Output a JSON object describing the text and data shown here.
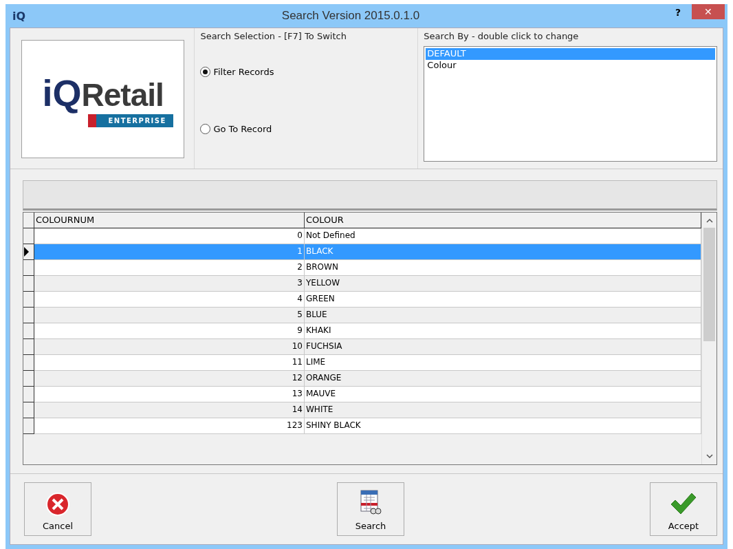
{
  "window": {
    "app_mark": "iQ",
    "title": "Search Version 2015.0.1.0",
    "help": "?",
    "close": "✕"
  },
  "logo": {
    "mark": "iQ",
    "name": "Retail",
    "tagline": "ENTERPRISE"
  },
  "search_selection": {
    "title": "Search Selection - [F7] To Switch",
    "options": [
      {
        "label": "Filter Records",
        "selected": true
      },
      {
        "label": "Go To Record",
        "selected": false
      }
    ]
  },
  "search_by": {
    "title": "Search By - double click to change",
    "items": [
      {
        "label": "DEFAULT",
        "selected": true
      },
      {
        "label": "Colour",
        "selected": false
      }
    ]
  },
  "table": {
    "columns": [
      "COLOURNUM",
      "COLOUR"
    ],
    "rows": [
      {
        "cells": [
          "0",
          "Not Defined"
        ],
        "selected": false
      },
      {
        "cells": [
          "1",
          "BLACK"
        ],
        "selected": true
      },
      {
        "cells": [
          "2",
          "BROWN"
        ],
        "selected": false
      },
      {
        "cells": [
          "3",
          "YELLOW"
        ],
        "selected": false
      },
      {
        "cells": [
          "4",
          "GREEN"
        ],
        "selected": false
      },
      {
        "cells": [
          "5",
          "BLUE"
        ],
        "selected": false
      },
      {
        "cells": [
          "9",
          "KHAKI"
        ],
        "selected": false
      },
      {
        "cells": [
          "10",
          "FUCHSIA"
        ],
        "selected": false
      },
      {
        "cells": [
          "11",
          "LIME"
        ],
        "selected": false
      },
      {
        "cells": [
          "12",
          "ORANGE"
        ],
        "selected": false
      },
      {
        "cells": [
          "13",
          "MAUVE"
        ],
        "selected": false
      },
      {
        "cells": [
          "14",
          "WHITE"
        ],
        "selected": false
      },
      {
        "cells": [
          "123",
          "SHINY BLACK"
        ],
        "selected": false
      }
    ]
  },
  "buttons": [
    {
      "kind": "cancel",
      "label": "Cancel"
    },
    {
      "kind": "search",
      "label": "Search"
    },
    {
      "kind": "accept",
      "label": "Accept"
    }
  ]
}
